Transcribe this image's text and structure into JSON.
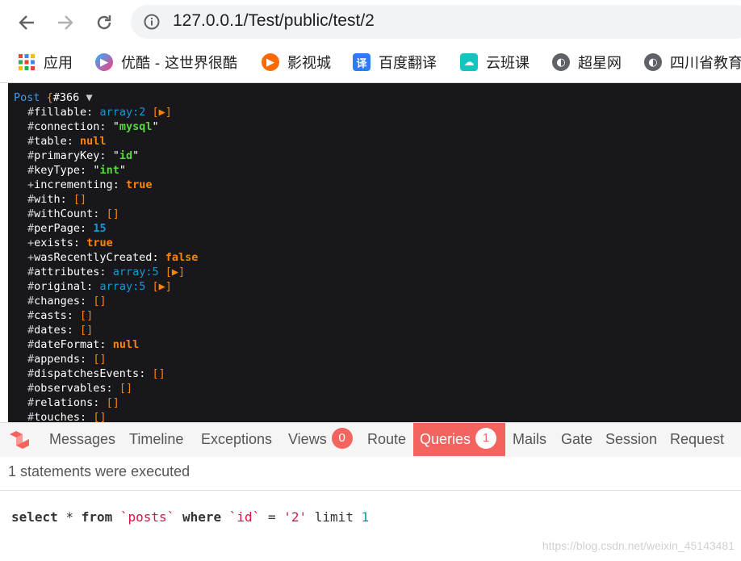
{
  "browser": {
    "url": "127.0.0.1/Test/public/test/2",
    "bookmarks": [
      {
        "label": "应用",
        "icon": "apps-grid-icon"
      },
      {
        "label": "优酷 - 这世界很酷",
        "icon": "youku-icon"
      },
      {
        "label": "影视城",
        "icon": "video-play-icon"
      },
      {
        "label": "百度翻译",
        "icon": "translate-icon"
      },
      {
        "label": "云班课",
        "icon": "cloud-class-icon"
      },
      {
        "label": "超星网",
        "icon": "globe-icon"
      },
      {
        "label": "四川省教育",
        "icon": "globe-icon"
      }
    ]
  },
  "dump": {
    "class_name": "Post",
    "open_brace": "{",
    "object_id": "#366",
    "toggle": "▼",
    "rows": [
      {
        "prefix": "#",
        "name": "fillable",
        "kind": "arr",
        "value": "array:2",
        "expand": "[▶]"
      },
      {
        "prefix": "#",
        "name": "connection",
        "kind": "str",
        "value": "mysql"
      },
      {
        "prefix": "#",
        "name": "table",
        "kind": "kw",
        "value": "null"
      },
      {
        "prefix": "#",
        "name": "primaryKey",
        "kind": "str",
        "value": "id"
      },
      {
        "prefix": "#",
        "name": "keyType",
        "kind": "str",
        "value": "int"
      },
      {
        "prefix": "+",
        "name": "incrementing",
        "kind": "kw",
        "value": "true"
      },
      {
        "prefix": "#",
        "name": "with",
        "kind": "brk",
        "value": "[]"
      },
      {
        "prefix": "#",
        "name": "withCount",
        "kind": "brk",
        "value": "[]"
      },
      {
        "prefix": "#",
        "name": "perPage",
        "kind": "num",
        "value": "15"
      },
      {
        "prefix": "+",
        "name": "exists",
        "kind": "kw",
        "value": "true"
      },
      {
        "prefix": "+",
        "name": "wasRecentlyCreated",
        "kind": "kw",
        "value": "false"
      },
      {
        "prefix": "#",
        "name": "attributes",
        "kind": "arr",
        "value": "array:5",
        "expand": "[▶]"
      },
      {
        "prefix": "#",
        "name": "original",
        "kind": "arr",
        "value": "array:5",
        "expand": "[▶]"
      },
      {
        "prefix": "#",
        "name": "changes",
        "kind": "brk",
        "value": "[]"
      },
      {
        "prefix": "#",
        "name": "casts",
        "kind": "brk",
        "value": "[]"
      },
      {
        "prefix": "#",
        "name": "dates",
        "kind": "brk",
        "value": "[]"
      },
      {
        "prefix": "#",
        "name": "dateFormat",
        "kind": "kw",
        "value": "null"
      },
      {
        "prefix": "#",
        "name": "appends",
        "kind": "brk",
        "value": "[]"
      },
      {
        "prefix": "#",
        "name": "dispatchesEvents",
        "kind": "brk",
        "value": "[]"
      },
      {
        "prefix": "#",
        "name": "observables",
        "kind": "brk",
        "value": "[]"
      },
      {
        "prefix": "#",
        "name": "relations",
        "kind": "brk",
        "value": "[]"
      },
      {
        "prefix": "#",
        "name": "touches",
        "kind": "brk",
        "value": "[]"
      }
    ]
  },
  "debugbar": {
    "tabs": [
      {
        "label": "Messages"
      },
      {
        "label": "Timeline"
      },
      {
        "label": "Exceptions"
      },
      {
        "label": "Views",
        "badge": "0"
      },
      {
        "label": "Route"
      },
      {
        "label": "Queries",
        "badge": "1",
        "active": true
      },
      {
        "label": "Mails"
      },
      {
        "label": "Gate"
      },
      {
        "label": "Session"
      },
      {
        "label": "Request"
      }
    ],
    "status": "1 statements were executed",
    "query": {
      "select": "select",
      "star": "*",
      "from": "from",
      "table": "`posts`",
      "where": "where",
      "column": "`id`",
      "op": "=",
      "value": "'2'",
      "limit": "limit",
      "limit_value": "1"
    },
    "accent": "#f4645f"
  },
  "watermark": "https://blog.csdn.net/weixin_45143481"
}
